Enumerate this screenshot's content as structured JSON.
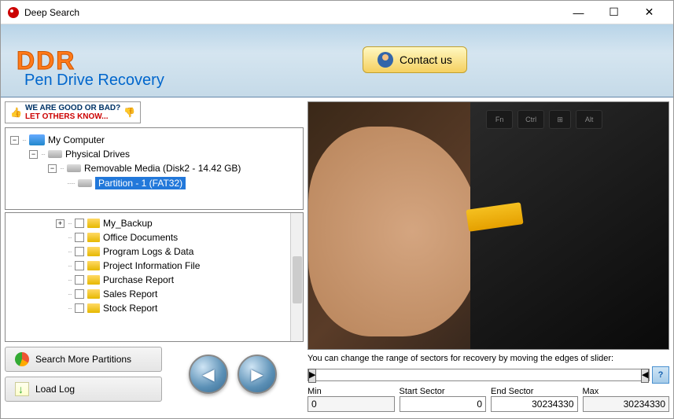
{
  "window": {
    "title": "Deep Search"
  },
  "header": {
    "logo": "DDR",
    "subtitle": "Pen Drive Recovery",
    "contact_label": "Contact us"
  },
  "review": {
    "line1": "WE ARE GOOD OR BAD?",
    "line2": "LET OTHERS KNOW..."
  },
  "drive_tree": {
    "root": "My Computer",
    "physical": "Physical Drives",
    "removable": "Removable Media (Disk2 - 14.42 GB)",
    "partition": "Partition - 1 (FAT32)"
  },
  "file_tree": [
    "My_Backup",
    "Office Documents",
    "Program Logs & Data",
    "Project Information File",
    "Purchase Report",
    "Sales Report",
    "Stock Report"
  ],
  "actions": {
    "search_partitions": "Search More Partitions",
    "load_log": "Load Log"
  },
  "keyboard": {
    "fn": "Fn",
    "ctrl": "Ctrl",
    "alt": "Alt"
  },
  "sectors": {
    "hint": "You can change the range of sectors for recovery by moving the edges of slider:",
    "min_label": "Min",
    "start_label": "Start Sector",
    "end_label": "End Sector",
    "max_label": "Max",
    "min": "0",
    "start": "0",
    "end": "30234330",
    "max": "30234330",
    "help": "?"
  }
}
